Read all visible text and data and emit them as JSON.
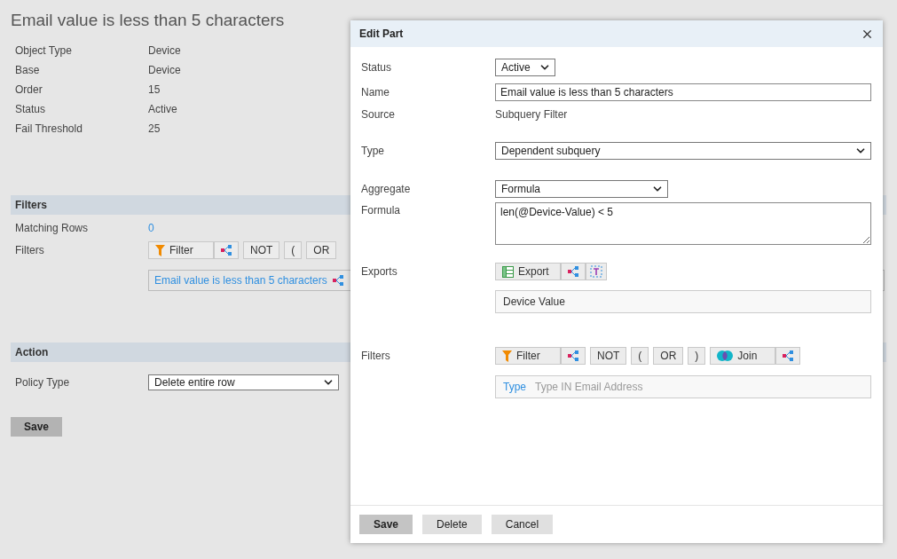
{
  "page": {
    "title": "Email value is less than 5 characters",
    "details": [
      {
        "label": "Object Type",
        "value": "Device"
      },
      {
        "label": "Base",
        "value": "Device"
      },
      {
        "label": "Order",
        "value": "15"
      },
      {
        "label": "Status",
        "value": "Active"
      },
      {
        "label": "Fail Threshold",
        "value": "25"
      }
    ],
    "filters_section": {
      "heading": "Filters",
      "matching_rows_label": "Matching Rows",
      "matching_rows_value": "0",
      "filters_label": "Filters",
      "toolbar": [
        {
          "kind": "filter",
          "label": "Filter"
        },
        {
          "kind": "tree"
        },
        {
          "kind": "text",
          "label": "NOT"
        },
        {
          "kind": "text",
          "label": "("
        },
        {
          "kind": "text",
          "label": "OR"
        }
      ],
      "chip": "Email value is less than 5 characters"
    },
    "action_section": {
      "heading": "Action",
      "policy_label": "Policy Type",
      "policy_value": "Delete entire row"
    },
    "save": "Save"
  },
  "dialog": {
    "title": "Edit Part",
    "status": {
      "label": "Status",
      "value": "Active"
    },
    "name": {
      "label": "Name",
      "value": "Email value is less than 5 characters"
    },
    "source": {
      "label": "Source",
      "value": "Subquery Filter"
    },
    "type": {
      "label": "Type",
      "value": "Dependent subquery"
    },
    "aggregate": {
      "label": "Aggregate",
      "value": "Formula"
    },
    "formula": {
      "label": "Formula",
      "value": "len(@Device-Value) < 5"
    },
    "exports": {
      "label": "Exports",
      "toolbar": [
        {
          "kind": "export",
          "label": "Export"
        },
        {
          "kind": "tree"
        },
        {
          "kind": "textframe"
        }
      ],
      "item": "Device Value"
    },
    "filters": {
      "label": "Filters",
      "toolbar": [
        {
          "kind": "filter",
          "label": "Filter"
        },
        {
          "kind": "tree"
        },
        {
          "kind": "text",
          "label": "NOT"
        },
        {
          "kind": "text",
          "label": "("
        },
        {
          "kind": "text",
          "label": "OR"
        },
        {
          "kind": "text",
          "label": ")"
        },
        {
          "kind": "join",
          "label": "Join"
        },
        {
          "kind": "tree"
        }
      ],
      "item_link": "Type",
      "item_text": "Type IN Email Address"
    },
    "buttons": [
      {
        "kind": "primary",
        "label": "Save"
      },
      {
        "kind": "plain",
        "label": "Delete"
      },
      {
        "kind": "plain",
        "label": "Cancel"
      }
    ]
  }
}
